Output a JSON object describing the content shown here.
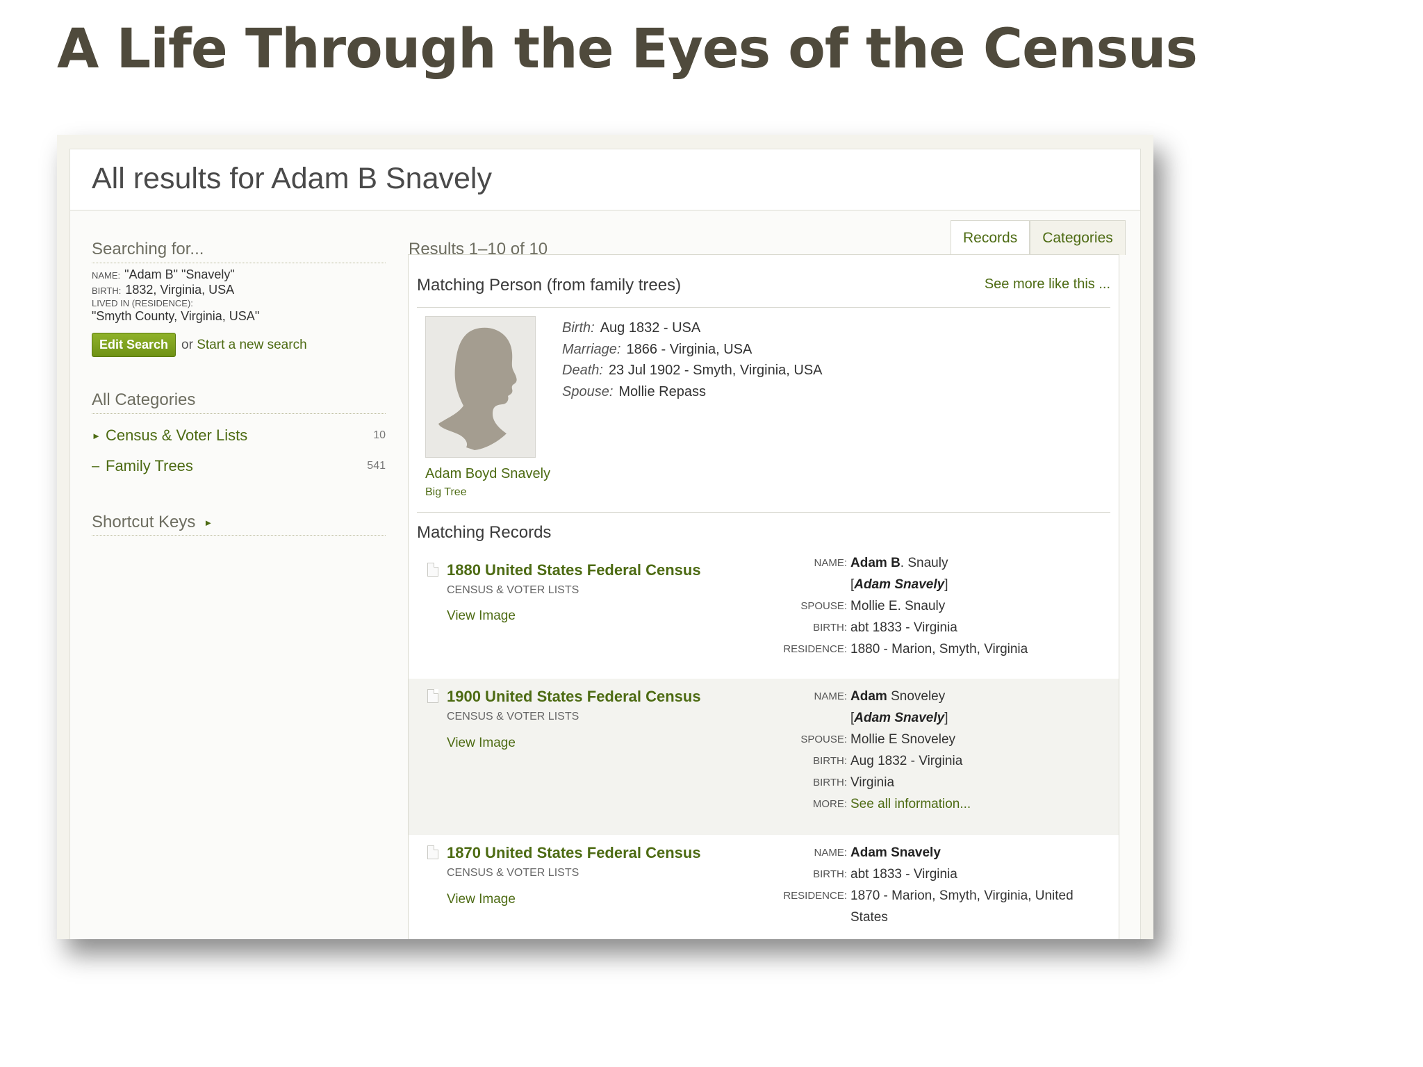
{
  "slide": {
    "title": "A Life Through the Eyes of the Census"
  },
  "page": {
    "title": "All results for Adam B Snavely"
  },
  "sidebar": {
    "searching_heading": "Searching for...",
    "criteria": {
      "name_label": "NAME:",
      "name_value": "\"Adam B\" \"Snavely\"",
      "birth_label": "BIRTH:",
      "birth_value": "1832, Virginia, USA",
      "lived_label": "LIVED IN (RESIDENCE):",
      "lived_value": "\"Smyth County, Virginia, USA\""
    },
    "edit_button": "Edit Search",
    "or_text": "or",
    "new_search_link": "Start a new search",
    "categories_heading": "All Categories",
    "categories": [
      {
        "label": "Census & Voter Lists",
        "count": "10"
      },
      {
        "label": "Family Trees",
        "count": "541"
      }
    ],
    "shortcut_keys": "Shortcut Keys"
  },
  "main": {
    "results_count": "Results 1–10 of 10",
    "tabs": [
      {
        "label": "Records"
      },
      {
        "label": "Categories"
      }
    ],
    "matching_person": {
      "heading": "Matching Person (from family trees)",
      "see_more": "See more like this ...",
      "name": "Adam Boyd Snavely",
      "tree": "Big Tree",
      "facts": [
        {
          "label": "Birth:",
          "value": "Aug 1832 - USA"
        },
        {
          "label": "Marriage:",
          "value": "1866 - Virginia, USA"
        },
        {
          "label": "Death:",
          "value": "23 Jul 1902 - Smyth, Virginia, USA"
        },
        {
          "label": "Spouse:",
          "value": "Mollie Repass"
        }
      ]
    },
    "matching_records_heading": "Matching Records",
    "records": [
      {
        "title": "1880 United States Federal Census",
        "category": "CENSUS & VOTER LISTS",
        "view": "View Image",
        "name_label": "NAME:",
        "name_first": "Adam B",
        "name_rest": ". Snauly",
        "alias": "Adam Snavely",
        "spouse_label": "SPOUSE:",
        "spouse": "Mollie E. Snauly",
        "birth_label": "BIRTH:",
        "birth": "abt 1833 - Virginia",
        "residence_label": "RESIDENCE:",
        "residence": "1880 - Marion, Smyth, Virginia"
      },
      {
        "title": "1900 United States Federal Census",
        "category": "CENSUS & VOTER LISTS",
        "view": "View Image",
        "name_label": "NAME:",
        "name_first": "Adam",
        "name_rest": " Snoveley",
        "alias": "Adam Snavely",
        "spouse_label": "SPOUSE:",
        "spouse": "Mollie E Snoveley",
        "birth_label": "BIRTH:",
        "birth": "Aug 1832 - Virginia",
        "birth2_label": "BIRTH:",
        "birth2": "Virginia",
        "more_label": "MORE:",
        "more": "See all information..."
      },
      {
        "title": "1870 United States Federal Census",
        "category": "CENSUS & VOTER LISTS",
        "view": "View Image",
        "name_label": "NAME:",
        "name_first": "Adam Snavely",
        "birth_label": "BIRTH:",
        "birth": "abt 1833 - Virginia",
        "residence_label": "RESIDENCE:",
        "residence": "1870 - Marion, Smyth, Virginia, United States"
      }
    ]
  },
  "colors": {
    "link_green": "#4d6b13",
    "button_green": "#7ea11f",
    "title_brown": "#4f4a3c"
  },
  "icons": [
    "person-silhouette-icon",
    "document-icon",
    "triangle-right-icon"
  ]
}
